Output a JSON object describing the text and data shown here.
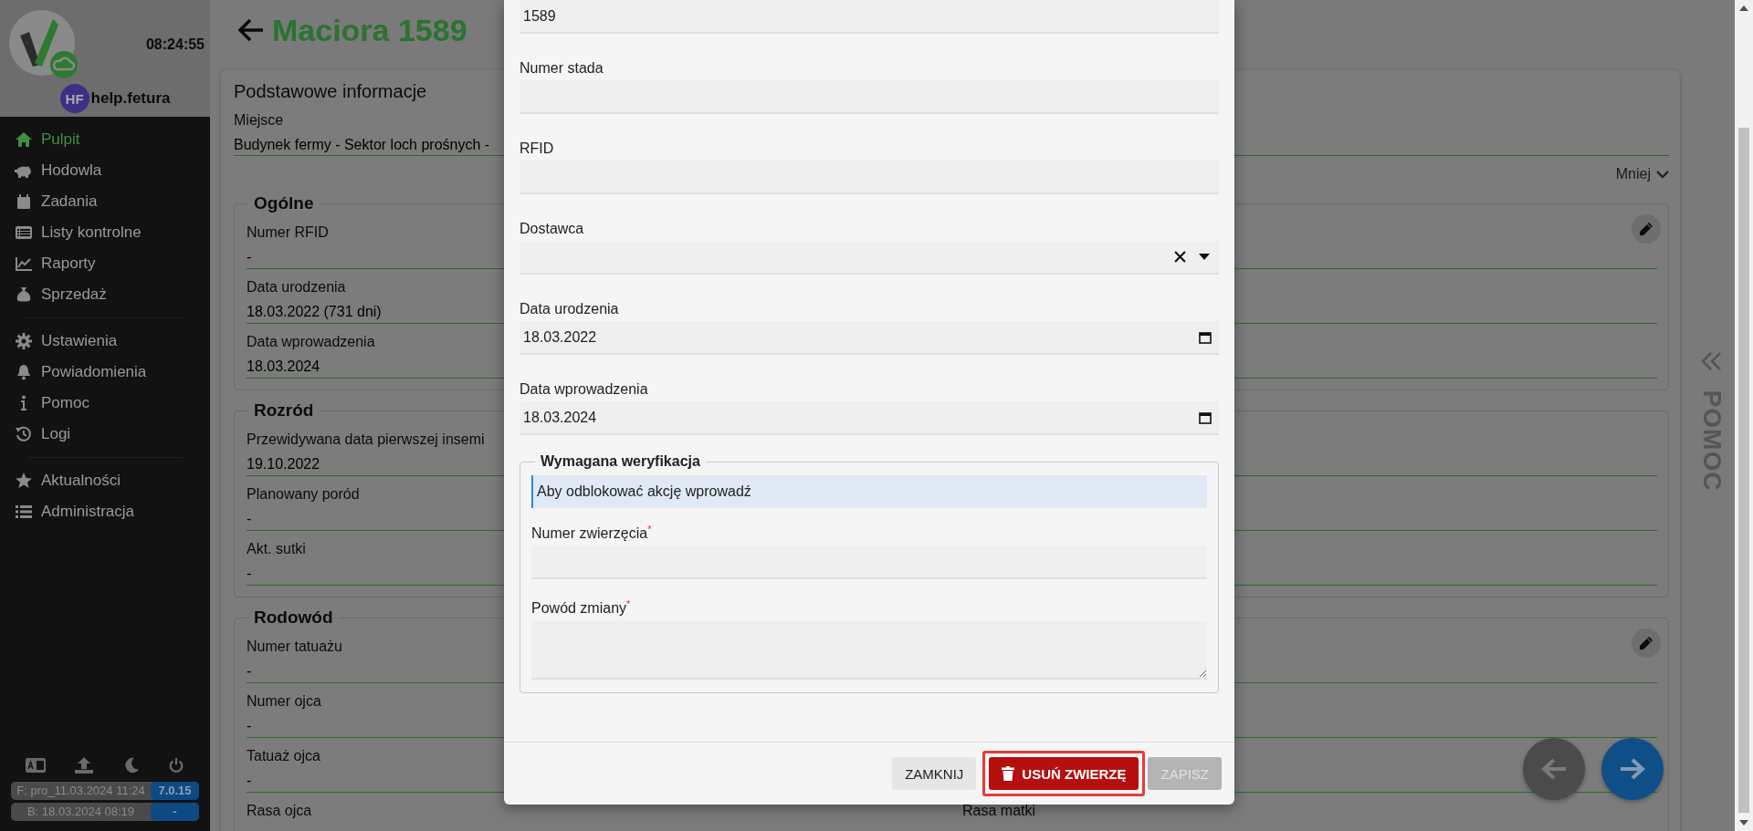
{
  "sidebar": {
    "time": "08:24:55",
    "user": {
      "initials": "HF",
      "name": "help.fetura"
    },
    "menu_groups": [
      [
        {
          "label": "Pulpit",
          "selected": true
        },
        {
          "label": "Hodowla",
          "selected": false
        },
        {
          "label": "Zadania",
          "selected": false
        },
        {
          "label": "Listy kontrolne",
          "selected": false
        },
        {
          "label": "Raporty",
          "selected": false
        },
        {
          "label": "Sprzedaż",
          "selected": false
        }
      ],
      [
        {
          "label": "Ustawienia",
          "selected": false
        },
        {
          "label": "Powiadomienia",
          "selected": false
        },
        {
          "label": "Pomoc",
          "selected": false
        },
        {
          "label": "Logi",
          "selected": false
        }
      ],
      [
        {
          "label": "Aktualności",
          "selected": false
        },
        {
          "label": "Administracja",
          "selected": false
        }
      ]
    ],
    "footer_badges": [
      {
        "label": "F: pro_11.03.2024 11:24",
        "value": "7.0.15"
      },
      {
        "label": "B: 18.03.2024 08:19",
        "value": "-"
      }
    ]
  },
  "page": {
    "title": "Maciora 1589",
    "card": {
      "title": "Podstawowe informacje",
      "location_label": "Miejsce",
      "location_value": "Budynek fermy - Sektor loch prośnych -",
      "toggle": "Mniej",
      "sections": [
        {
          "title": "Ogólne",
          "editable": true,
          "rows": [
            {
              "label": "Numer RFID",
              "value": "-"
            },
            {
              "label": "Data urodzenia",
              "value": "18.03.2022 (731 dni)"
            },
            {
              "label": "Data wprowadzenia",
              "value": "18.03.2024"
            }
          ]
        },
        {
          "title": "Rozród",
          "editable": false,
          "rows": [
            {
              "label": "Przewidywana data pierwszej insemi",
              "value": "19.10.2022"
            },
            {
              "label": "Planowany poród",
              "value": "-"
            },
            {
              "label": "Akt. sutki",
              "value": "-"
            }
          ]
        },
        {
          "title": "Rodowód",
          "editable": true,
          "rows": [
            {
              "label": "Numer tatuażu",
              "value": "-"
            },
            {
              "label": "Numer ojca",
              "value": "-"
            },
            {
              "label": "Tatuaż ojca",
              "value": "-"
            },
            {
              "label": "Rasa ojca",
              "right_label": "Rasa matki"
            }
          ]
        }
      ]
    }
  },
  "help_panel": {
    "label": "POMOC"
  },
  "dialog": {
    "fields": [
      {
        "kind": "text",
        "value": "1589"
      },
      {
        "kind": "text",
        "label": "Numer stada"
      },
      {
        "kind": "text",
        "label": "RFID"
      },
      {
        "kind": "select",
        "label": "Dostawca"
      },
      {
        "kind": "date",
        "label": "Data urodzenia",
        "value": "18.03.2022"
      },
      {
        "kind": "date",
        "label": "Data wprowadzenia",
        "value": "18.03.2024"
      }
    ],
    "verification": {
      "title": "Wymagana weryfikacja",
      "info": "Aby odblokować akcję wprowadź",
      "fields": [
        {
          "kind": "text",
          "label": "Numer zwierzęcia",
          "required_mark": "*"
        },
        {
          "kind": "textarea",
          "label": "Powód zmiany",
          "required_mark": "*"
        }
      ]
    },
    "buttons": [
      {
        "kind": "close",
        "label": "ZAMKNIJ",
        "disabled": false,
        "highlighted": false
      },
      {
        "kind": "delete",
        "label": "USUŃ ZWIERZĘ",
        "disabled": false,
        "highlighted": true
      },
      {
        "kind": "save",
        "label": "ZAPISZ",
        "disabled": true,
        "highlighted": false
      }
    ]
  }
}
